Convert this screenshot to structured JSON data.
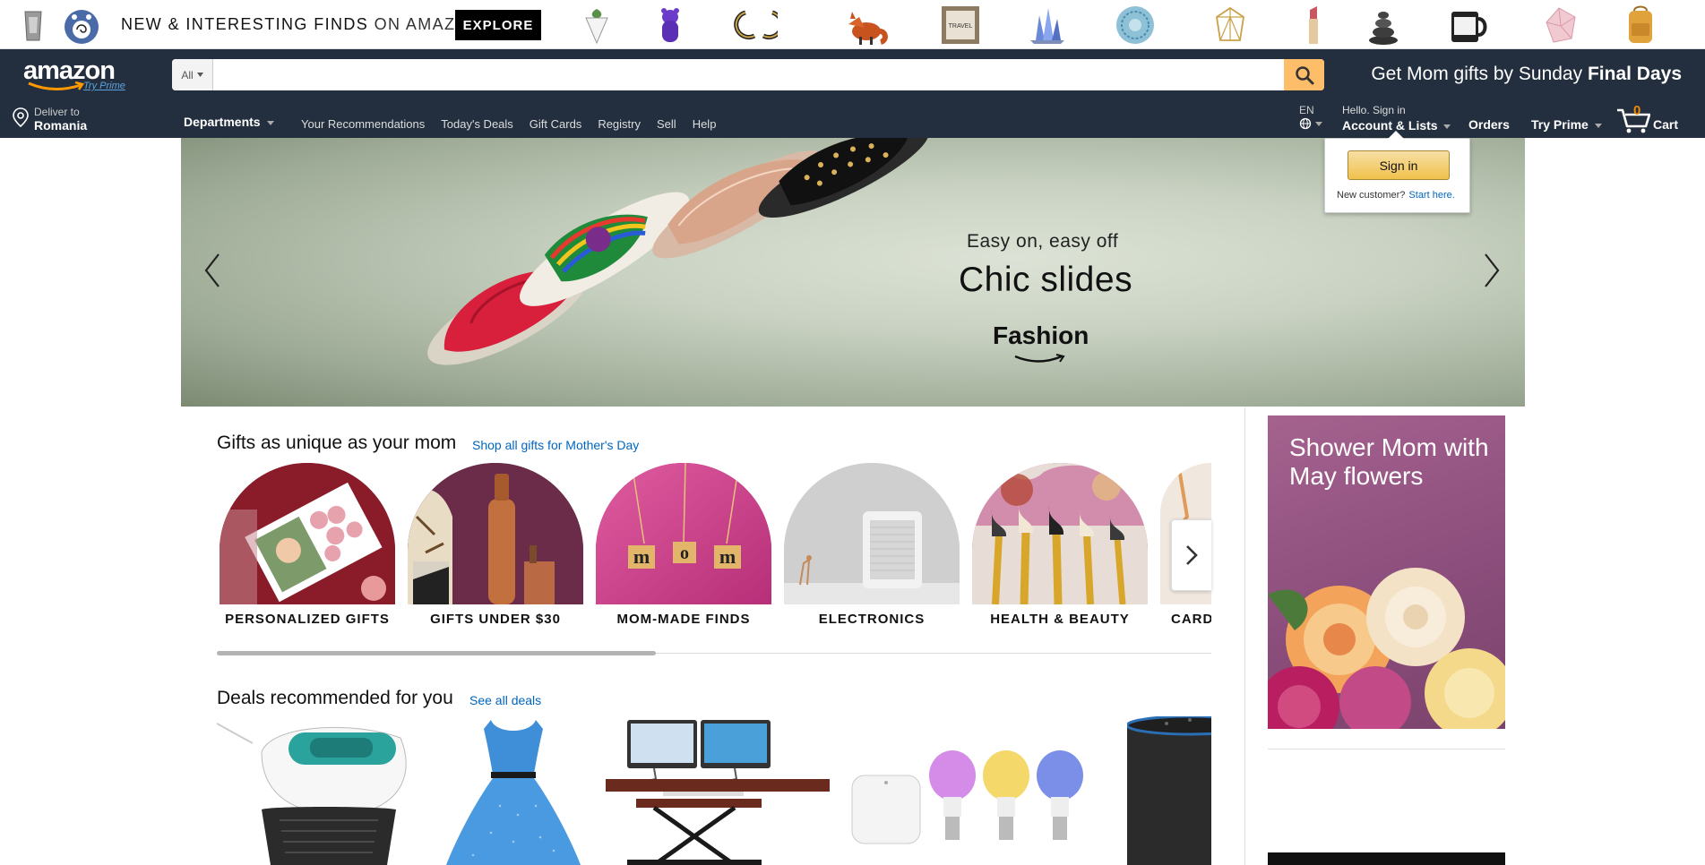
{
  "promo": {
    "headline": "NEW & INTERESTING FINDS",
    "headline_suffix": " ON AMAZON",
    "explore_label": "EXPLORE",
    "items": [
      "tarot-pouch",
      "poliwhirl-plush",
      "gummy-bear-lamp",
      "planter-hanger",
      "crescent-earrings",
      "fox-figurine",
      "travel-shadowbox",
      "crystal-cluster",
      "mandala-tapestry",
      "geometric-terrarium",
      "lipstick-tube",
      "stone-cairn-fountain",
      "coffee-mug",
      "rose-quartz",
      "canvas-backpack"
    ]
  },
  "nav": {
    "logo_text": "amazon",
    "try_prime_link": "Try Prime",
    "search": {
      "category": "All",
      "value": "",
      "placeholder": ""
    },
    "swm_text": "Get Mom gifts by Sunday ",
    "swm_bold": "Final Days",
    "deliver_line1": "Deliver to",
    "deliver_line2": "Romania",
    "departments": "Departments",
    "links": [
      "Your Recommendations",
      "Today's Deals",
      "Gift Cards",
      "Registry",
      "Sell",
      "Help"
    ],
    "lang": "EN",
    "greeting": "Hello. Sign in",
    "account": "Account & Lists",
    "orders": "Orders",
    "try_prime": "Try Prime",
    "cart_count": "0",
    "cart_label": "Cart"
  },
  "flyout": {
    "signin_label": "Sign in",
    "new_customer": "New customer?",
    "start_here": "Start here."
  },
  "hero": {
    "subtitle": "Easy on, easy off",
    "title": "Chic slides",
    "brand": "Fashion"
  },
  "gifts": {
    "title": "Gifts as unique as your mom",
    "link": "Shop all gifts for Mother's Day",
    "categories": [
      "PERSONALIZED GIFTS",
      "GIFTS UNDER $30",
      "MOM-MADE FINDS",
      "ELECTRONICS",
      "HEALTH & BEAUTY",
      "CARD"
    ]
  },
  "deals": {
    "title": "Deals recommended for you",
    "link": "See all deals"
  },
  "ad": {
    "text": "Shower Mom with May flowers"
  },
  "colors": {
    "nav_bg": "#232f3e",
    "search_button": "#febd69",
    "link": "#0066c0",
    "cart_count": "#f08804",
    "signin_button": "#f0c14b"
  }
}
